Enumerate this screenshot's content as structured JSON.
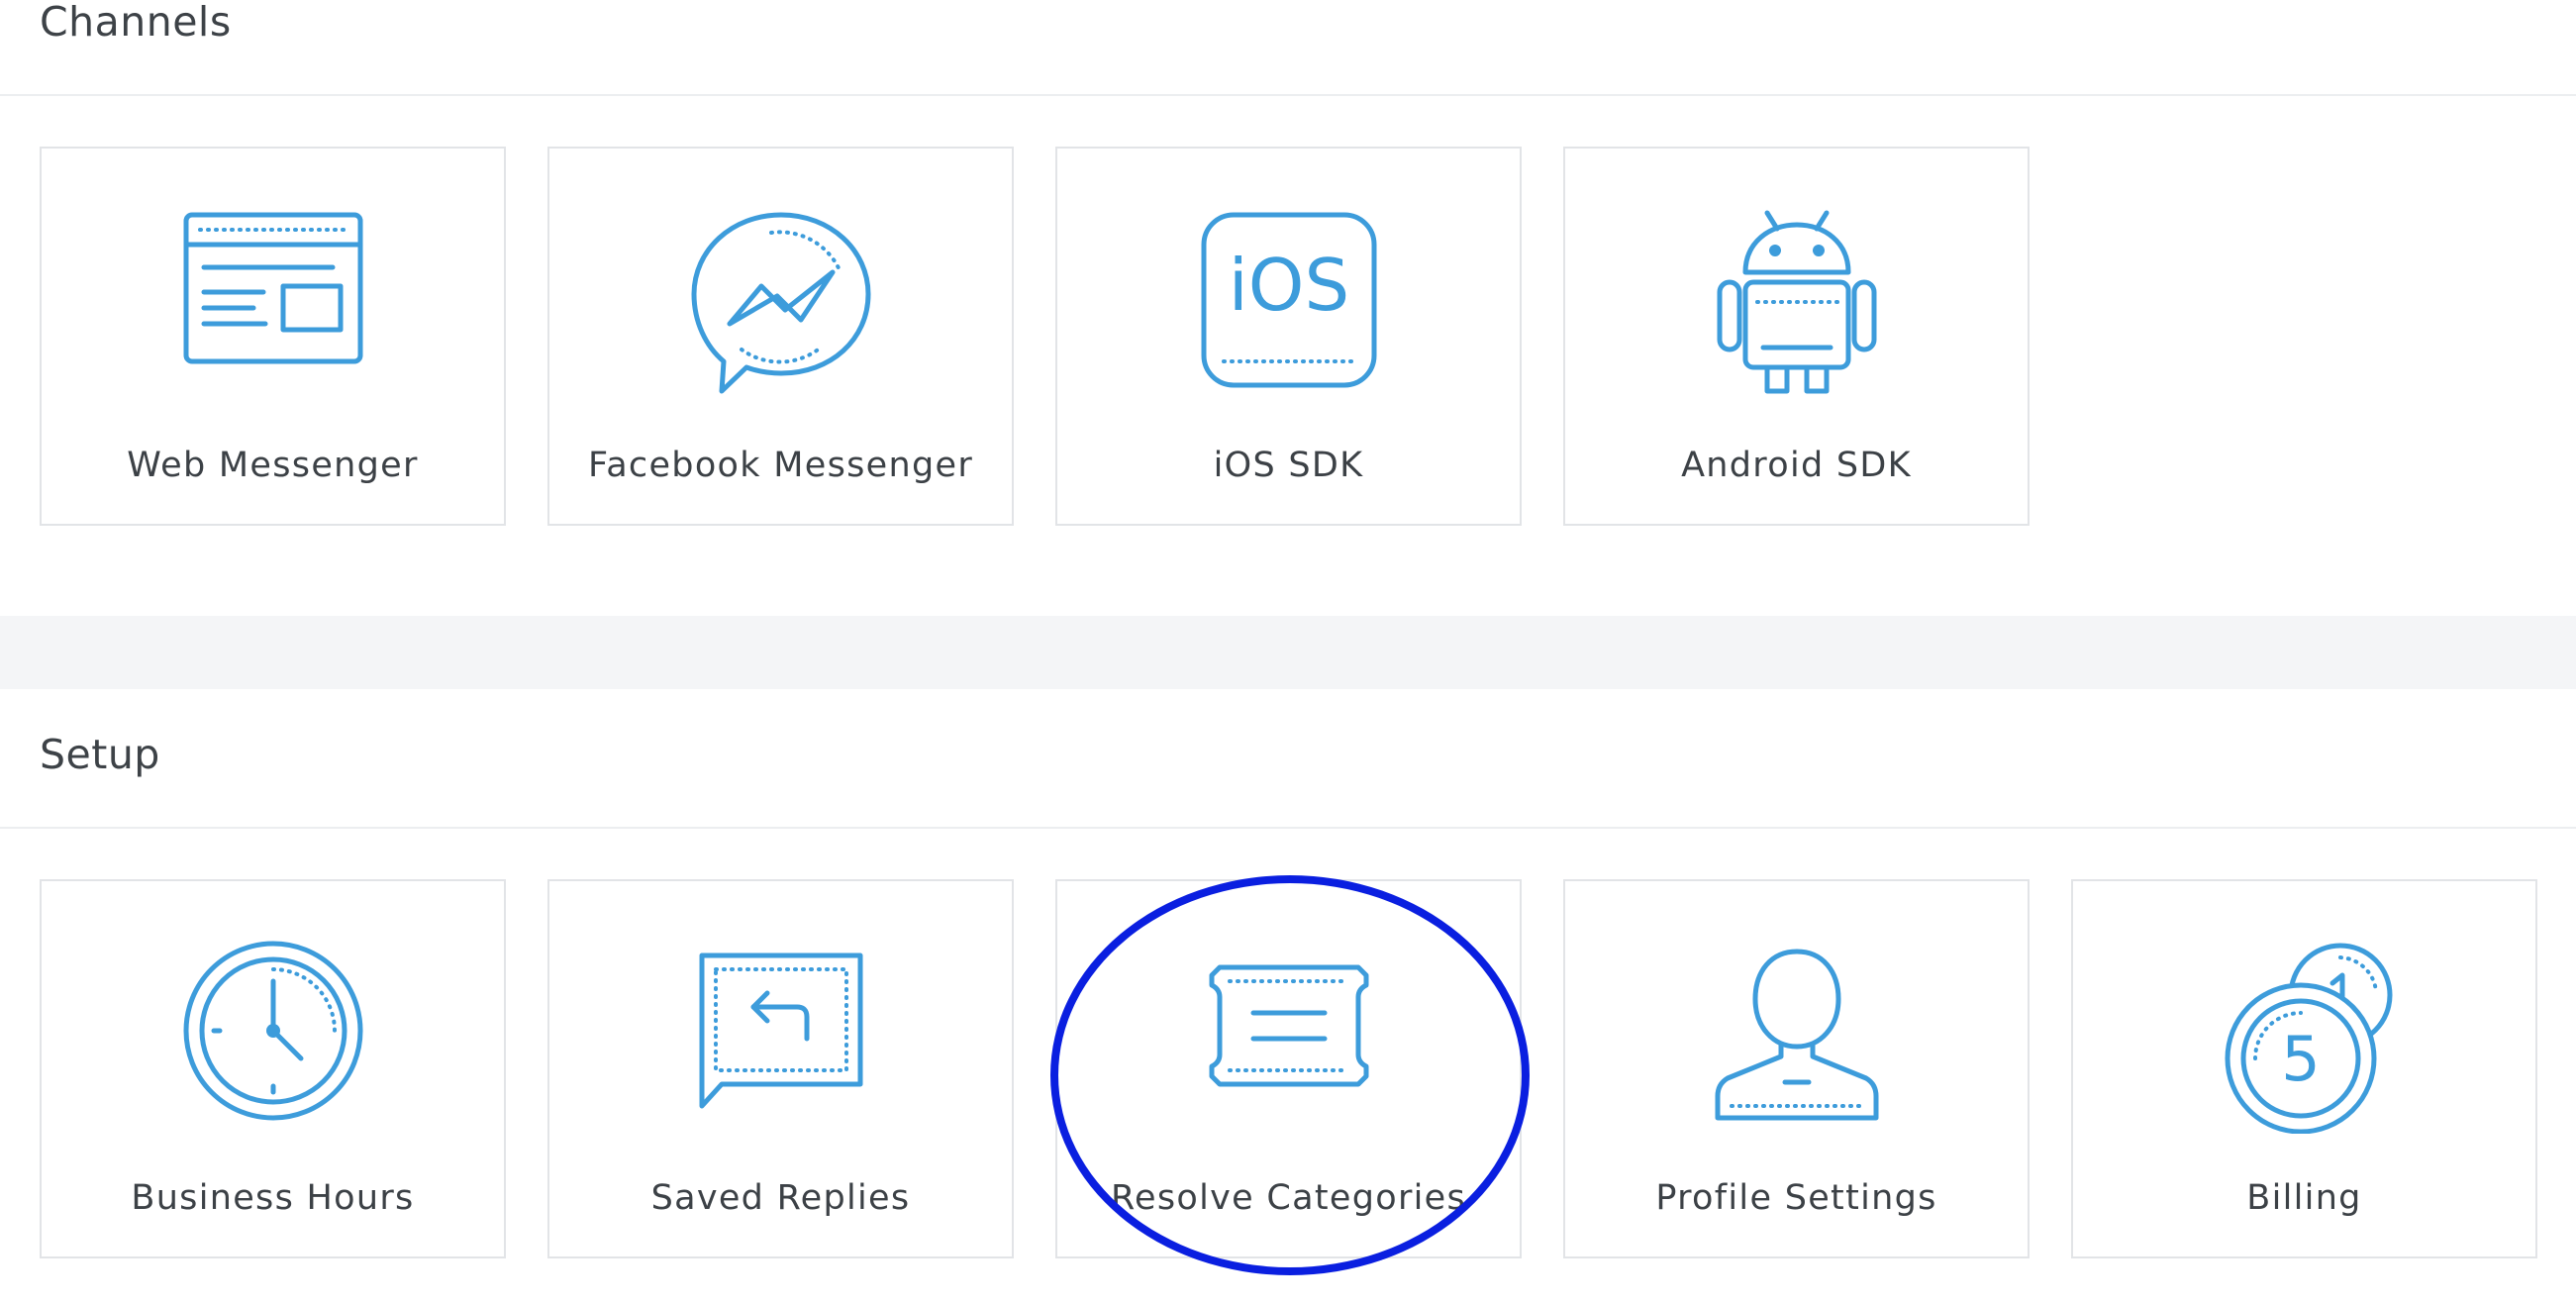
{
  "sections": {
    "channels": {
      "title": "Channels",
      "cards": [
        {
          "label": "Web Messenger",
          "icon": "web-browser-icon"
        },
        {
          "label": "Facebook Messenger",
          "icon": "messenger-bolt-icon"
        },
        {
          "label": "iOS SDK",
          "icon": "ios-badge-icon",
          "icon_text": "iOS"
        },
        {
          "label": "Android SDK",
          "icon": "android-robot-icon"
        }
      ]
    },
    "setup": {
      "title": "Setup",
      "cards": [
        {
          "label": "Business Hours",
          "icon": "clock-icon"
        },
        {
          "label": "Saved Replies",
          "icon": "reply-bubble-icon"
        },
        {
          "label": "Resolve Categories",
          "icon": "ticket-icon",
          "highlighted": true
        },
        {
          "label": "Profile Settings",
          "icon": "user-profile-icon"
        },
        {
          "label": "Billing",
          "icon": "coins-icon",
          "icon_text": "5"
        }
      ]
    }
  },
  "colors": {
    "icon": "#3d9cdb",
    "card_border": "#e2e4e7",
    "band": "#f4f5f7",
    "highlight": "#0a1fe0",
    "text": "#3c4146"
  }
}
